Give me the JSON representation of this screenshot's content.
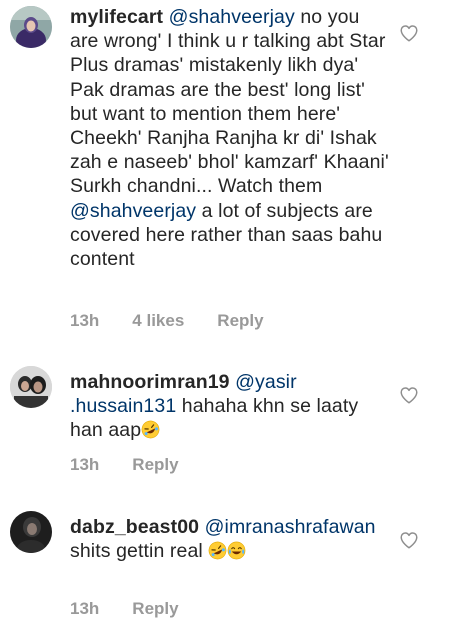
{
  "comments": [
    {
      "username": "mylifecart",
      "mention": "@shahveerjay",
      "text_a": " no you are wrong' I think u r talking abt Star Plus dramas' mistakenly likh dya' Pak dramas are the best' long list' but want to mention them here' Cheekh' Ranjha Ranjha kr di' Ishak zah e naseeb' bhol' kamzarf' Khaani' Surkh chandni... Watch them ",
      "mention2": "@shahveerjay",
      "text_b": "  a lot of subjects are covered here rather than saas bahu content",
      "time": "13h",
      "likes": "4 likes",
      "reply": "Reply"
    },
    {
      "username": "mahnoorimran19",
      "mention": "@yasir .hussain131",
      "text_a": " hahaha khn se laaty han aap",
      "emojis": [
        "rofl-emoji"
      ],
      "time": "13h",
      "reply": "Reply"
    },
    {
      "username": "dabz_beast00",
      "mention": "@imranashrafawan",
      "text_a": " shits gettin real ",
      "emojis": [
        "rofl-emoji",
        "joy-emoji"
      ],
      "time": "13h",
      "reply": "Reply"
    }
  ],
  "colors": {
    "text": "#262626",
    "mention": "#003569",
    "meta": "#999999",
    "heart_outline": "#8e8e8e"
  },
  "icons": [
    "heart-outline-icon"
  ]
}
